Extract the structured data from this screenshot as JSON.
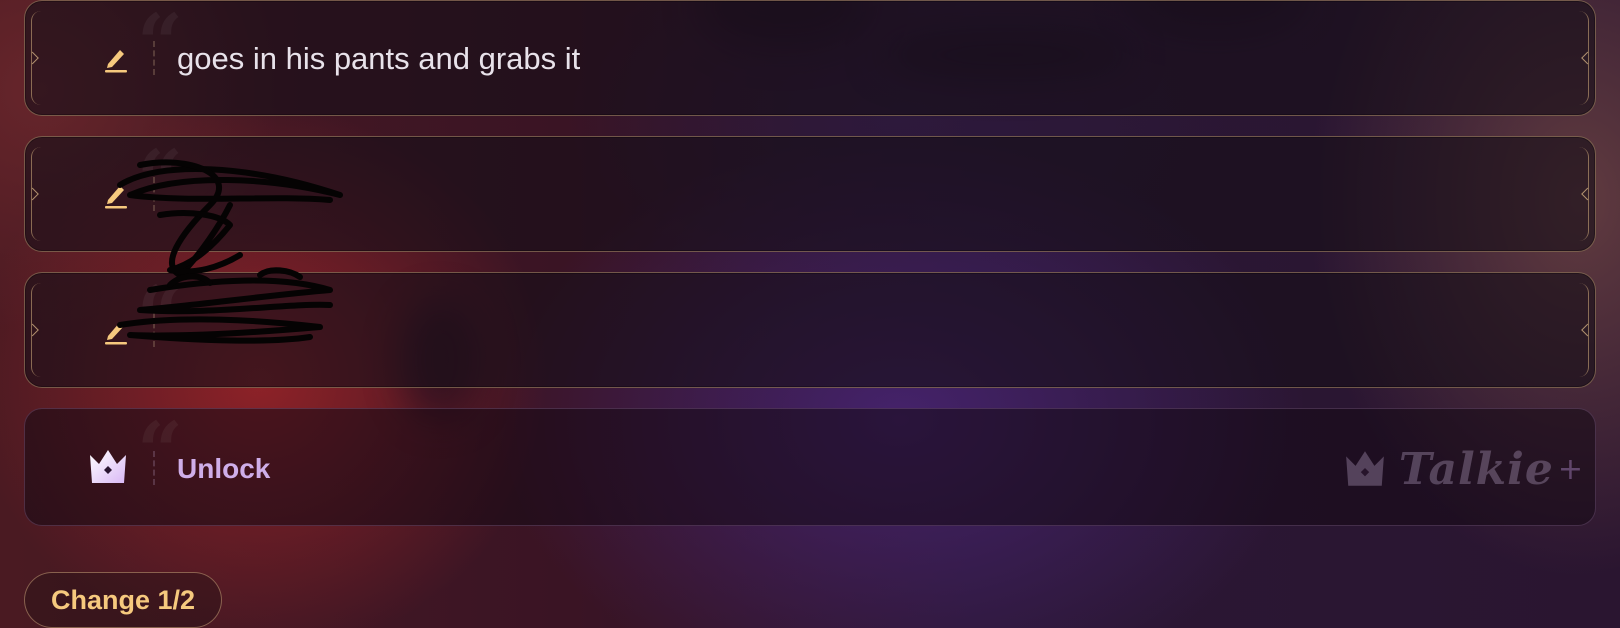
{
  "options": [
    {
      "text": "goes in his pants and grabs it",
      "redacted": false
    },
    {
      "text": "",
      "redacted": true
    },
    {
      "text": "",
      "redacted": true
    }
  ],
  "unlock": {
    "label": "Unlock"
  },
  "brand": {
    "name": "Talkie",
    "plus_glyph": "+"
  },
  "change_button": {
    "label": "Change 1/2"
  },
  "colors": {
    "edit_icon": "#f6c97e",
    "unlock_text": "#cfaee9",
    "change_text": "#f6c97e",
    "option_text": "#e8e2ea"
  },
  "icons": {
    "option": "edit-icon",
    "unlock": "crown-icon",
    "quote": "quote-icon"
  }
}
